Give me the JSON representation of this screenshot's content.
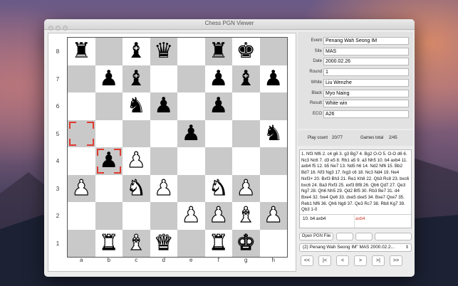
{
  "window": {
    "title": "Chess PGN Viewer"
  },
  "board": {
    "ranks": [
      "8",
      "7",
      "6",
      "5",
      "4",
      "3",
      "2",
      "1"
    ],
    "files": [
      "a",
      "b",
      "c",
      "d",
      "e",
      "f",
      "g",
      "h"
    ],
    "rows": [
      [
        "r",
        "",
        "b",
        "q",
        "",
        "r",
        "k",
        ""
      ],
      [
        "",
        "p",
        "b",
        "",
        "",
        "p",
        "b",
        "p"
      ],
      [
        "",
        "",
        "n",
        "p",
        "",
        "p",
        "",
        ""
      ],
      [
        "",
        "",
        "",
        "",
        "p",
        "",
        "",
        "n"
      ],
      [
        "",
        "p",
        "P",
        "",
        "",
        "",
        "",
        ""
      ],
      [
        "P",
        "",
        "N",
        "P",
        "",
        "N",
        "P",
        ""
      ],
      [
        "",
        "",
        "",
        "",
        "P",
        "P",
        "B",
        "P"
      ],
      [
        "",
        "R",
        "B",
        "Q",
        "",
        "R",
        "K",
        ""
      ]
    ],
    "highlight_squares": [
      "a5",
      "b4"
    ]
  },
  "game_info": [
    {
      "label": "Event",
      "value": "Penang Wah Seong IM"
    },
    {
      "label": "Site",
      "value": "MAS"
    },
    {
      "label": "Date",
      "value": "2000.02.26"
    },
    {
      "label": "Round",
      "value": "1"
    },
    {
      "label": "White",
      "value": "Liu Wenzhe"
    },
    {
      "label": "Black",
      "value": "Myo Naing"
    },
    {
      "label": "Result",
      "value": "White win"
    },
    {
      "label": "ECO",
      "value": "A26"
    }
  ],
  "stats": {
    "play_count_label": "Play count",
    "play_count_value": "20/77",
    "games_total_label": "Games total",
    "games_total_value": "2/45"
  },
  "movetext": "1. Nf3 Nf6 2. c4 g6 3. g3 Bg7 4. Bg2 O-O 5. O-O d6 6. Nc3 Nc6 7. d3 e5 8. Rb1 a5 9. a3 Nh5 10. b4 axb4 11. axb4 f5 12. b5 Ne7 13. Nd5 h6 14. Nd2 Nf6 15. Bb2 Bd7 16. Nf3 Ng3 17. fxg3 c6 18. Nc3 Nd4 19. Ne4 Nxf3+ 20. Bxf3 Bh3 21. Re1 Kh8 22. Qb3 Rc8 23. bxc6 bxc6 24. Ba3 Rxf3 25. exf3 Bf8 26. Qb6 Qd7 27. Qe3 Ng7 28. Qh6 Nh5 29. Qd2 Bf5 30. Rb3 Be7 31. d4 Bxe4 32. fxe4 Qe6 33. dxe5 dxe5 34. Bxe7 Qxe7 35. Reb1 Nf6 36. Qh6 Ng8 37. Qe3 Rc7 38. Rb8 Kg7 39. Qb3 1-0",
  "current_move": "10. b4 axb4",
  "next_move": "axb4",
  "buttons": {
    "open_pgn": "Open PGN File"
  },
  "game_select": {
    "selected": "(2) Penang Wah Seong IM\" MAS 2000.02.2..."
  },
  "nav": [
    "<<",
    "|<",
    "<",
    ">",
    ">|",
    ">>"
  ]
}
